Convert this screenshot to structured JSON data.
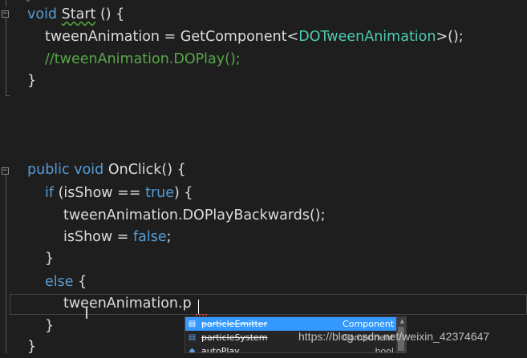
{
  "editor": {
    "lines": [
      [
        {
          "t": "void",
          "c": "kw"
        },
        {
          "t": " ",
          "c": "txt"
        },
        {
          "t": "Start",
          "c": "txt",
          "squiggle": "green"
        },
        {
          "t": " () {",
          "c": "txt"
        }
      ],
      [
        {
          "t": "tweenAnimation = GetComponent<",
          "c": "txt"
        },
        {
          "t": "DOTweenAnimation",
          "c": "type"
        },
        {
          "t": ">();",
          "c": "txt"
        }
      ],
      [
        {
          "t": "//tweenAnimation.DOPlay();",
          "c": "comment"
        }
      ],
      [
        {
          "t": "}",
          "c": "txt"
        }
      ],
      [
        {
          "t": "public",
          "c": "kw"
        },
        {
          "t": " ",
          "c": "txt"
        },
        {
          "t": "void",
          "c": "kw"
        },
        {
          "t": " OnClick() {",
          "c": "txt"
        }
      ],
      [
        {
          "t": "if",
          "c": "kw"
        },
        {
          "t": " (isShow == ",
          "c": "txt"
        },
        {
          "t": "true",
          "c": "kw"
        },
        {
          "t": ") {",
          "c": "txt"
        }
      ],
      [
        {
          "t": "tweenAnimation.DOPlayBackwards();",
          "c": "txt"
        }
      ],
      [
        {
          "t": "isShow = ",
          "c": "txt"
        },
        {
          "t": "false",
          "c": "kw"
        },
        {
          "t": ";",
          "c": "txt"
        }
      ],
      [
        {
          "t": "}",
          "c": "txt"
        }
      ],
      [
        {
          "t": "else",
          "c": "kw"
        },
        {
          "t": " {",
          "c": "txt"
        }
      ],
      [
        {
          "t": "tweenAnimation.p",
          "c": "txt"
        }
      ],
      [
        {
          "t": "}",
          "c": "txt"
        }
      ],
      [
        {
          "t": "}",
          "c": "txt"
        }
      ]
    ]
  },
  "autocomplete": {
    "items": [
      {
        "name": "particleEmitter",
        "type": "Component",
        "selected": true,
        "obsolete": true,
        "icon": "property-icon"
      },
      {
        "name": "particleSystem",
        "type": "Component",
        "selected": false,
        "obsolete": true,
        "icon": "property-icon"
      },
      {
        "name": "autoPlay",
        "type": "bool",
        "selected": false,
        "obsolete": false,
        "icon": "field-icon"
      }
    ]
  },
  "watermark": "https://blog.csdn.net/weixin_42374647",
  "colors": {
    "background": "#1e1e1e",
    "keyword": "#569cd6",
    "type": "#4ec9b0",
    "comment": "#57a64a",
    "text": "#dcdcdc",
    "selection": "#3399ff"
  }
}
